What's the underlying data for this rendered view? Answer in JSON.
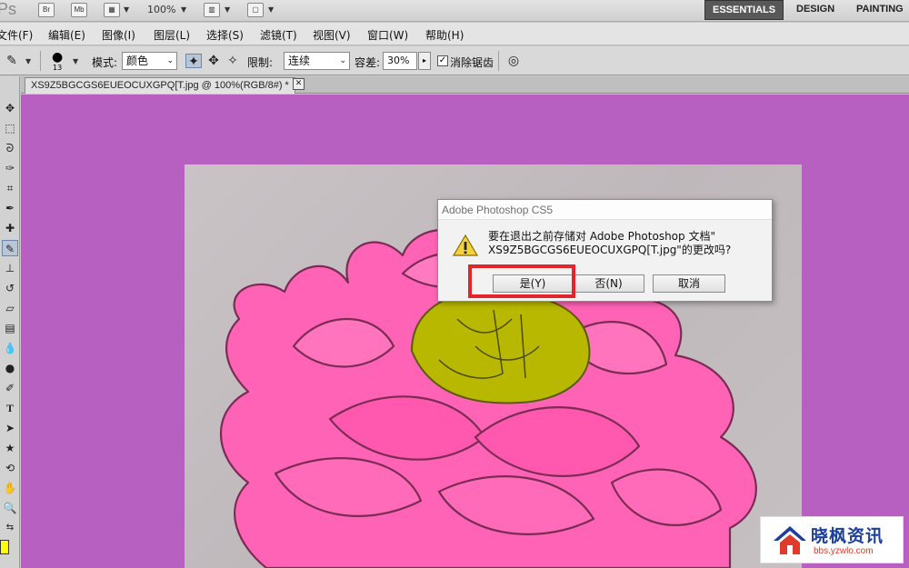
{
  "app_bar": {
    "logo": "Ps",
    "bridge_button": "Br",
    "minibridge_button": "Mb",
    "zoom_level": "100%",
    "workspaces": [
      "ESSENTIALS",
      "DESIGN",
      "PAINTING"
    ]
  },
  "menu": [
    "文件(F)",
    "编辑(E)",
    "图像(I)",
    "图层(L)",
    "选择(S)",
    "滤镜(T)",
    "视图(V)",
    "窗口(W)",
    "帮助(H)"
  ],
  "options": {
    "brush_size": "13",
    "mode_label": "模式:",
    "mode_value": "颜色",
    "limits_label": "限制:",
    "limits_value": "连续",
    "tolerance_label": "容差:",
    "tolerance_value": "30%",
    "antialias_label": "消除锯齿",
    "antialias_checked": true
  },
  "document": {
    "tab_title": "XS9Z5BGCGS6EUEOCUXGPQ[T.jpg @ 100%(RGB/8#) *"
  },
  "dialog": {
    "title": "Adobe Photoshop CS5",
    "message_line1": "要在退出之前存储对 Adobe Photoshop 文档\"",
    "message_line2": "XS9Z5BGCGS6EUEOCUXGPQ[T.jpg\"的更改吗?",
    "yes_button": "是(Y)",
    "no_button": "否(N)",
    "cancel_button": "取消"
  },
  "watermark": {
    "title": "晓枫资讯",
    "url": "bbs.yzwlo.com"
  },
  "colors": {
    "canvas_bg": "#b760c2",
    "flower_pink": "#ff5fb2",
    "center_yellow": "#b8b800",
    "highlight_red": "#e3242b",
    "foreground_swatch": "#ffff00"
  }
}
